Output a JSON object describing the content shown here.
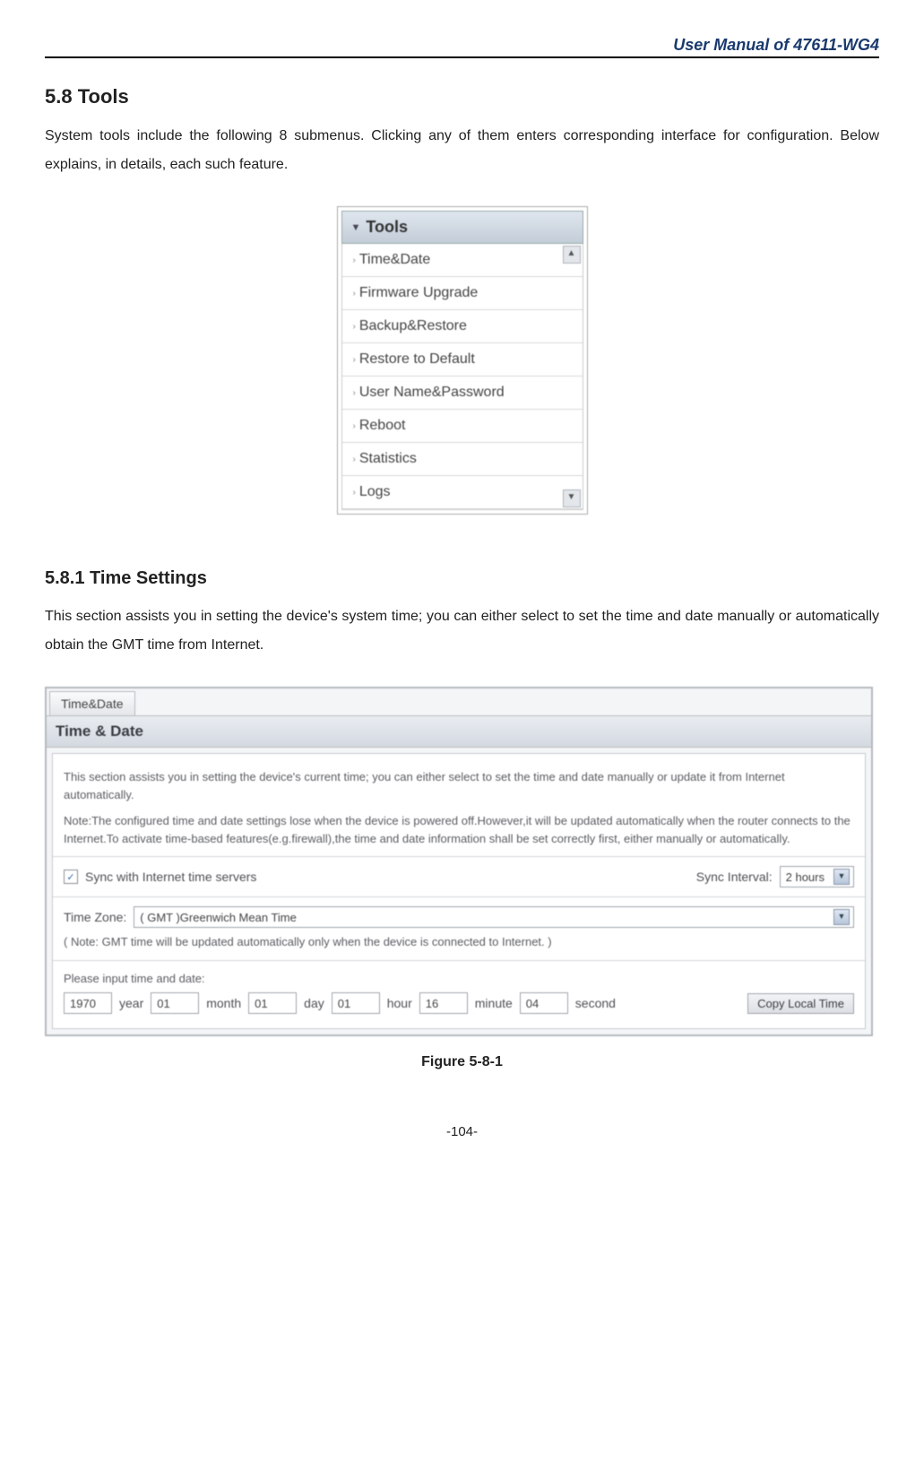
{
  "header": {
    "title": "User Manual of 47611-WG4"
  },
  "section": {
    "number_title": "5.8  Tools",
    "intro": "System tools include the following 8 submenus. Clicking any of them enters corresponding interface for configuration. Below explains, in details, each such feature."
  },
  "tools_menu": {
    "heading": "Tools",
    "items": [
      "Time&Date",
      "Firmware Upgrade",
      "Backup&Restore",
      "Restore to Default",
      "User Name&Password",
      "Reboot",
      "Statistics",
      "Logs"
    ]
  },
  "subsection": {
    "number_title": "5.8.1  Time Settings",
    "intro": "This section assists you in setting the device's system time; you can either select to set the time and date manually or automatically obtain the GMT time from Internet."
  },
  "time_panel": {
    "tab": "Time&Date",
    "title": "Time & Date",
    "desc": "This section assists you in setting the device's current time; you can either select to set the time and date manually or update it from Internet automatically.",
    "note": "Note:The configured time and date settings lose when the device is powered off.However,it will be updated automatically when the router connects to the Internet.To activate time-based features(e.g.firewall),the time and date information shall be set correctly first, either manually or automatically.",
    "sync_label": "Sync with Internet time servers",
    "sync_interval_label": "Sync Interval:",
    "sync_interval_value": "2 hours",
    "tz_label": "Time Zone:",
    "tz_value": "( GMT )Greenwich Mean Time",
    "gmt_note": "( Note: GMT time will be updated automatically only when the device is connected to Internet. )",
    "input_prompt": "Please input time and date:",
    "fields": {
      "year": "1970",
      "year_lbl": "year",
      "month": "01",
      "month_lbl": "month",
      "day": "01",
      "day_lbl": "day",
      "hour": "01",
      "hour_lbl": "hour",
      "minute": "16",
      "minute_lbl": "minute",
      "second": "04",
      "second_lbl": "second"
    },
    "copy_btn": "Copy Local Time"
  },
  "figure_caption": "Figure 5-8-1",
  "page_number": "-104-"
}
